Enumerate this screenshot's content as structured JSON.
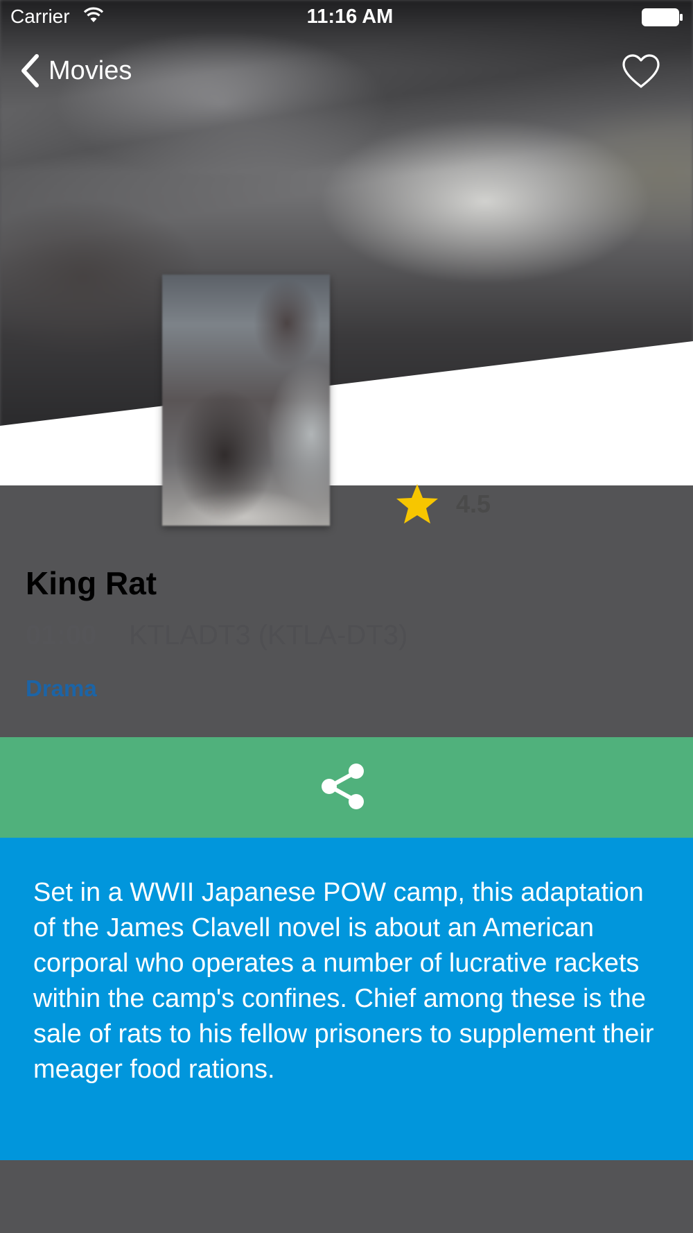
{
  "status_bar": {
    "carrier": "Carrier",
    "time": "11:16 AM",
    "icons": [
      "wifi-icon",
      "battery-icon"
    ]
  },
  "nav": {
    "back_label": "Movies",
    "back_icon": "chevron-left-icon",
    "favorite_icon": "heart-outline-icon"
  },
  "movie": {
    "title": "King Rat",
    "rating": "4.5",
    "rating_icon": "star-icon",
    "rating_color": "#F7C600",
    "time": "01:00",
    "channel": "KTLADT3 (KTLA-DT3)",
    "genre": "Drama",
    "genre_color": "#1C64A6",
    "description": "Set in a WWII Japanese POW camp, this adaptation of the James Clavell novel is about an American corporal who operates a number of lucrative rackets within the camp's confines. Chief among these is the sale of rats to his fellow prisoners to supplement their meager food rations."
  },
  "share": {
    "icon": "share-icon",
    "color": "#50B17C"
  },
  "colors": {
    "description_background": "#0196DC",
    "footer_background": "#545456"
  }
}
